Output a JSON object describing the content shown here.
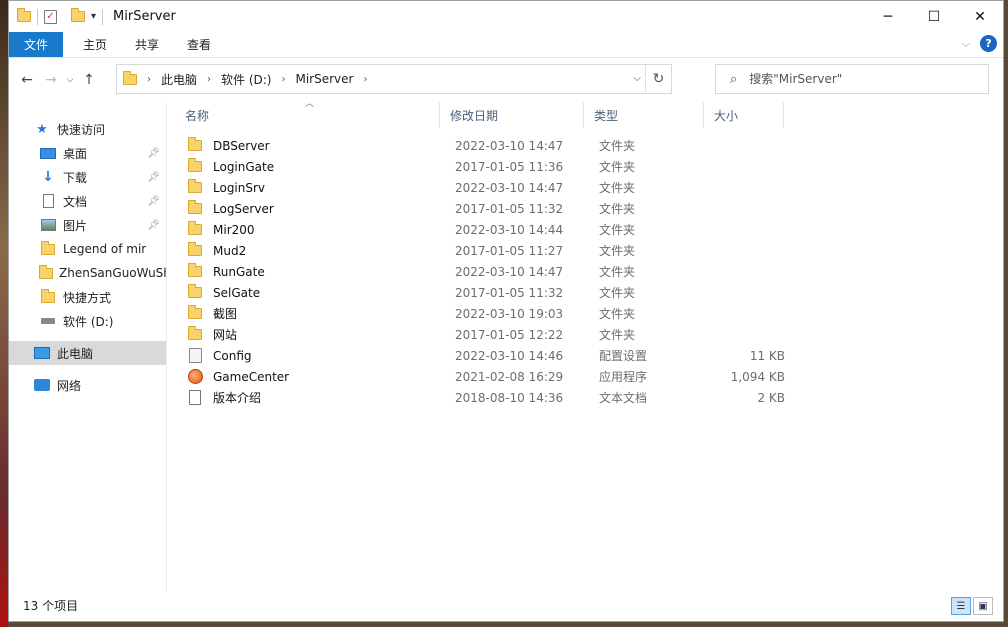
{
  "window": {
    "title": "MirServer"
  },
  "ribbon": {
    "tabs": [
      "文件",
      "主页",
      "共享",
      "查看"
    ]
  },
  "address": {
    "crumbs": [
      "此电脑",
      "软件 (D:)",
      "MirServer"
    ]
  },
  "search": {
    "placeholder": "搜索\"MirServer\""
  },
  "navpane": {
    "quick_access": "快速访问",
    "items": [
      {
        "label": "桌面",
        "icon": "desktop-icon",
        "pinned": true
      },
      {
        "label": "下载",
        "icon": "download-icon",
        "pinned": true
      },
      {
        "label": "文档",
        "icon": "document-icon",
        "pinned": true
      },
      {
        "label": "图片",
        "icon": "picture-icon",
        "pinned": true
      },
      {
        "label": "Legend of mir",
        "icon": "folder-icon",
        "pinned": false
      },
      {
        "label": "ZhenSanGuoWuSh",
        "icon": "folder-icon",
        "pinned": false
      },
      {
        "label": "快捷方式",
        "icon": "folder-icon",
        "pinned": false
      },
      {
        "label": "软件 (D:)",
        "icon": "drive-icon",
        "pinned": false
      }
    ],
    "this_pc": "此电脑",
    "network": "网络"
  },
  "columns": {
    "name": "名称",
    "date": "修改日期",
    "type": "类型",
    "size": "大小"
  },
  "files": [
    {
      "name": "DBServer",
      "date": "2022-03-10 14:47",
      "type": "文件夹",
      "size": "",
      "icon": "folder-icon"
    },
    {
      "name": "LoginGate",
      "date": "2017-01-05 11:36",
      "type": "文件夹",
      "size": "",
      "icon": "folder-icon"
    },
    {
      "name": "LoginSrv",
      "date": "2022-03-10 14:47",
      "type": "文件夹",
      "size": "",
      "icon": "folder-icon"
    },
    {
      "name": "LogServer",
      "date": "2017-01-05 11:32",
      "type": "文件夹",
      "size": "",
      "icon": "folder-icon"
    },
    {
      "name": "Mir200",
      "date": "2022-03-10 14:44",
      "type": "文件夹",
      "size": "",
      "icon": "folder-icon"
    },
    {
      "name": "Mud2",
      "date": "2017-01-05 11:27",
      "type": "文件夹",
      "size": "",
      "icon": "folder-icon"
    },
    {
      "name": "RunGate",
      "date": "2022-03-10 14:47",
      "type": "文件夹",
      "size": "",
      "icon": "folder-icon"
    },
    {
      "name": "SelGate",
      "date": "2017-01-05 11:32",
      "type": "文件夹",
      "size": "",
      "icon": "folder-icon"
    },
    {
      "name": "截图",
      "date": "2022-03-10 19:03",
      "type": "文件夹",
      "size": "",
      "icon": "folder-icon"
    },
    {
      "name": "网站",
      "date": "2017-01-05 12:22",
      "type": "文件夹",
      "size": "",
      "icon": "folder-icon"
    },
    {
      "name": "Config",
      "date": "2022-03-10 14:46",
      "type": "配置设置",
      "size": "11 KB",
      "icon": "config-icon"
    },
    {
      "name": "GameCenter",
      "date": "2021-02-08 16:29",
      "type": "应用程序",
      "size": "1,094 KB",
      "icon": "app-icon"
    },
    {
      "name": "版本介绍",
      "date": "2018-08-10 14:36",
      "type": "文本文档",
      "size": "2 KB",
      "icon": "text-file-icon"
    }
  ],
  "status": {
    "count": "13 个项目"
  },
  "colors": {
    "accent": "#1979ca",
    "folder": "#f7d36a"
  }
}
